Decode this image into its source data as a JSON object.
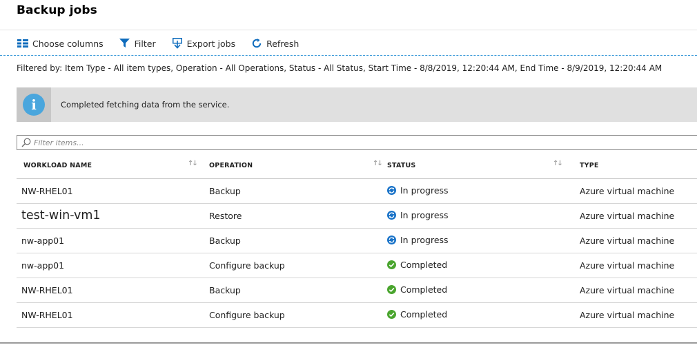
{
  "page": {
    "title": "Backup jobs"
  },
  "toolbar": {
    "choose_columns": "Choose columns",
    "filter": "Filter",
    "export_jobs": "Export jobs",
    "refresh": "Refresh"
  },
  "filter_summary": "Filtered by: Item Type - All item types, Operation - All Operations, Status - All Status, Start Time - 8/8/2019, 12:20:44 AM, End Time - 8/9/2019, 12:20:44 AM",
  "info_bar": {
    "message": "Completed fetching data from the service.",
    "icon": "info-icon"
  },
  "search": {
    "placeholder": "Filter items...",
    "value": ""
  },
  "table": {
    "columns": [
      "WORKLOAD NAME",
      "OPERATION",
      "STATUS",
      "TYPE"
    ],
    "rows": [
      {
        "workload": "NW-RHEL01",
        "operation": "Backup",
        "status": "In progress",
        "type": "Azure virtual machine"
      },
      {
        "workload": "test-win-vm1",
        "operation": "Restore",
        "status": "In progress",
        "type": "Azure virtual machine"
      },
      {
        "workload": "nw-app01",
        "operation": "Backup",
        "status": "In progress",
        "type": "Azure virtual machine"
      },
      {
        "workload": "nw-app01",
        "operation": "Configure backup",
        "status": "Completed",
        "type": "Azure virtual machine"
      },
      {
        "workload": "NW-RHEL01",
        "operation": "Backup",
        "status": "Completed",
        "type": "Azure virtual machine"
      },
      {
        "workload": "NW-RHEL01",
        "operation": "Configure backup",
        "status": "Completed",
        "type": "Azure virtual machine"
      }
    ]
  },
  "colors": {
    "accent_blue": "#0f6cbd",
    "in_progress": "#1a73c8",
    "completed": "#4aa52e",
    "info": "#4aa6dd"
  }
}
